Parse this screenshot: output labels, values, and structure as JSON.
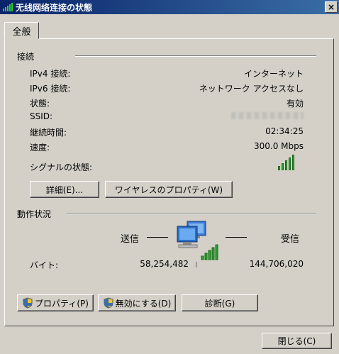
{
  "window": {
    "title": "无线网络连接の状態",
    "close_label": "×"
  },
  "tab": {
    "label": "全般"
  },
  "connection": {
    "section_label": "接続",
    "rows": [
      {
        "label": "IPv4 接続:",
        "value": "インターネット"
      },
      {
        "label": "IPv6 接続:",
        "value": "ネットワーク アクセスなし"
      },
      {
        "label": "状態:",
        "value": "有効"
      },
      {
        "label": "SSID:",
        "value": ""
      },
      {
        "label": "継続時間:",
        "value": "02:34:25"
      },
      {
        "label": "速度:",
        "value": "300.0 Mbps"
      },
      {
        "label": "シグナルの状態:",
        "value": ""
      }
    ],
    "signal_strength": 5,
    "details_button": "詳細(E)...",
    "wireless_props_button": "ワイヤレスのプロパティ(W)"
  },
  "activity": {
    "section_label": "動作状況",
    "sent_label": "送信",
    "received_label": "受信",
    "bytes_label": "バイト:",
    "bytes_sent": "58,254,482",
    "bytes_received": "144,706,020"
  },
  "actions": {
    "properties_button": "プロパティ(P)",
    "disable_button": "無効にする(D)",
    "diagnose_button": "診断(G)"
  },
  "footer": {
    "close_button": "閉じる(C)"
  },
  "colors": {
    "signal": "#2e9e2e",
    "titlebar": "#0a246a",
    "background": "#d4d0c8"
  }
}
